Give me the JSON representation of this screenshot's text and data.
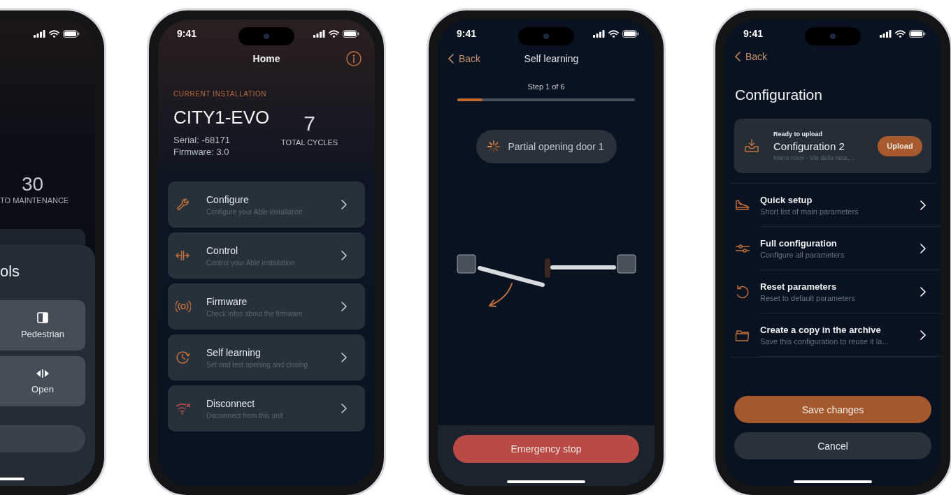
{
  "phones": [
    {
      "kind": "controls",
      "maintenance_count": "30",
      "maintenance_label": "TO MAINTENANCE",
      "panel_title": "ols",
      "controls": [
        {
          "label": "Pedestrian"
        },
        {
          "label": "Open"
        }
      ]
    },
    {
      "kind": "home",
      "time": "9:41",
      "title": "Home",
      "section_label": "CURRENT INSTALLATION",
      "installation_name": "CITY1-EVO",
      "serial": "Serial: -68171",
      "firmware": "Firmware: 3.0",
      "cycles_count": "7",
      "cycles_label": "TOTAL CYCLES",
      "menu": [
        {
          "title": "Configure",
          "subtitle": "Configure your Able installation",
          "color": "#c4703a"
        },
        {
          "title": "Control",
          "subtitle": "Control your Able installation",
          "color": "#c4703a"
        },
        {
          "title": "Firmware",
          "subtitle": "Check infos about the firmware",
          "color": "#c4703a"
        },
        {
          "title": "Self learning",
          "subtitle": "Set and test opening and closing",
          "color": "#c4703a"
        },
        {
          "title": "Disconnect",
          "subtitle": "Disconnect from this unit",
          "color": "#c24f45"
        }
      ]
    },
    {
      "kind": "self_learning",
      "time": "9:41",
      "back": "Back",
      "title": "Self learning",
      "step": "Step 1 of 6",
      "progress": {
        "level": 0.14
      },
      "status": "Partial opening door 1",
      "action": "Emergency stop"
    },
    {
      "kind": "configuration",
      "time": "9:41",
      "back": "Back",
      "title": "Configuration",
      "upload_card": {
        "label": "Ready to upload",
        "name": "Configuration 2",
        "detail": "Mario rossi - Via della seta,...",
        "button": "Upload"
      },
      "options": [
        {
          "title": "Quick setup",
          "subtitle": "Short list of main parameters"
        },
        {
          "title": "Full configuration",
          "subtitle": "Configure all parameters"
        },
        {
          "title": "Reset parameters",
          "subtitle": "Reset to default parameters"
        },
        {
          "title": "Create a copy in the archive",
          "subtitle": "Save this configuration to reuse it la..."
        }
      ],
      "buttons": [
        {
          "label": "Save changes",
          "primary": true
        },
        {
          "label": "Cancel",
          "primary": false
        }
      ]
    }
  ]
}
